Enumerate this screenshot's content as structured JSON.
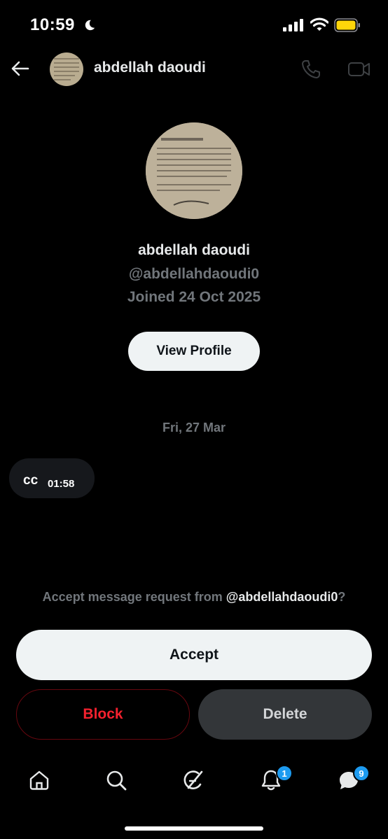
{
  "status_bar": {
    "time": "10:59"
  },
  "header": {
    "name": "abdellah daoudi"
  },
  "profile": {
    "name": "abdellah daoudi",
    "handle": "@abdellahdaoudi0",
    "joined": "Joined 24 Oct 2025",
    "view_profile_label": "View Profile"
  },
  "conversation": {
    "date_separator": "Fri, 27 Mar",
    "messages": [
      {
        "text": "cc",
        "time": "01:58"
      }
    ]
  },
  "request": {
    "prompt_prefix": "Accept message request from ",
    "handle": "@abdellahdaoudi0",
    "prompt_suffix": "?",
    "accept_label": "Accept",
    "block_label": "Block",
    "delete_label": "Delete"
  },
  "bottom_nav": {
    "items": [
      "home-icon",
      "search-icon",
      "grok-icon",
      "notifications-icon",
      "messages-icon"
    ],
    "notifications_badge": "1",
    "messages_badge": "9"
  },
  "colors": {
    "background": "#000000",
    "muted_text": "#71767b",
    "block_red": "#f4212e",
    "badge_blue": "#1d9bf0",
    "battery_yellow": "#ffd60a"
  }
}
